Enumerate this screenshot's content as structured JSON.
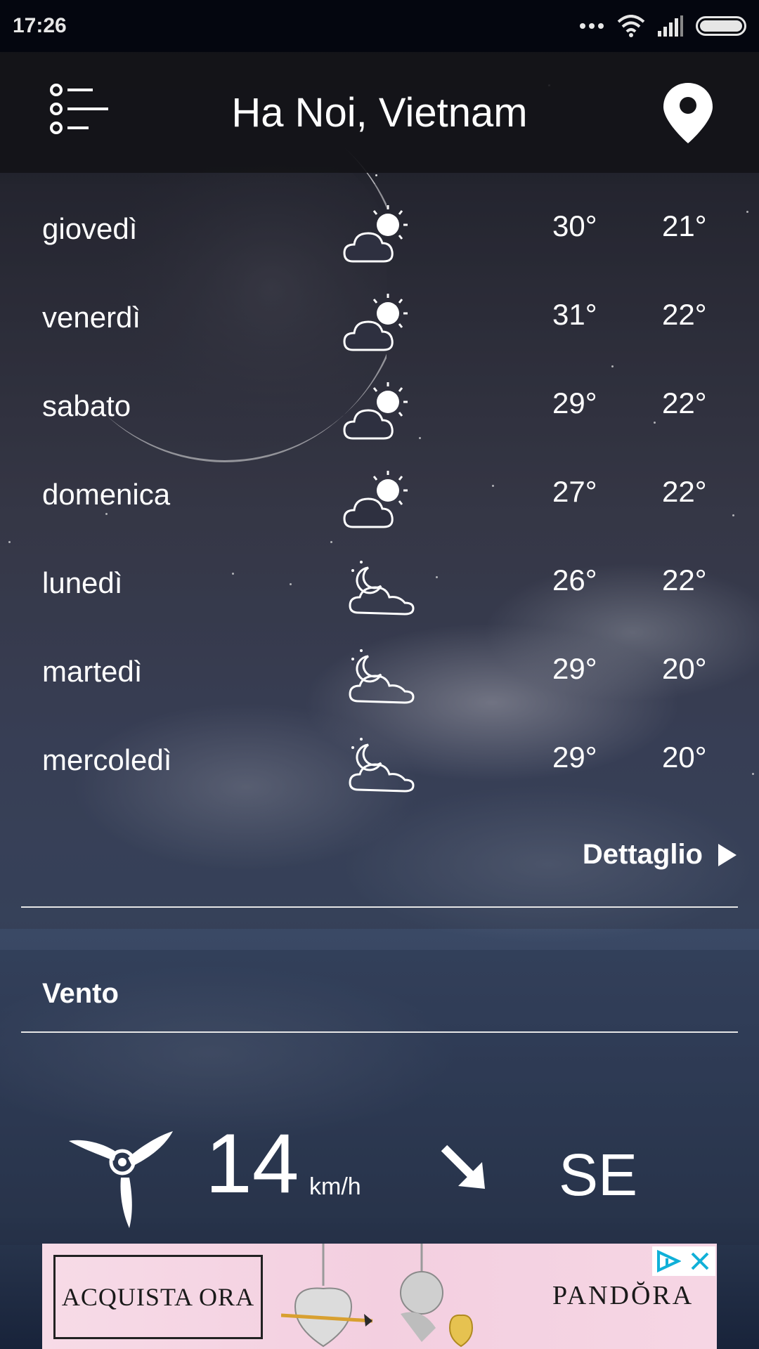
{
  "status_bar": {
    "time": "17:26",
    "icons": [
      "more-dots-icon",
      "wifi-icon",
      "signal-icon",
      "battery-icon"
    ]
  },
  "header": {
    "title": "Ha Noi, Vietnam",
    "menu_icon": "list-menu-icon",
    "location_icon": "location-pin-icon"
  },
  "forecast": {
    "days": [
      {
        "day": "giovedì",
        "icon": "partly-sunny-icon",
        "high": "30°",
        "low": "21°"
      },
      {
        "day": "venerdì",
        "icon": "partly-sunny-icon",
        "high": "31°",
        "low": "22°"
      },
      {
        "day": "sabato",
        "icon": "partly-sunny-icon",
        "high": "29°",
        "low": "22°"
      },
      {
        "day": "domenica",
        "icon": "partly-sunny-icon",
        "high": "27°",
        "low": "22°"
      },
      {
        "day": "lunedì",
        "icon": "night-cloudy-icon",
        "high": "26°",
        "low": "22°"
      },
      {
        "day": "martedì",
        "icon": "night-cloudy-icon",
        "high": "29°",
        "low": "20°"
      },
      {
        "day": "mercoledì",
        "icon": "night-cloudy-icon",
        "high": "29°",
        "low": "20°"
      }
    ],
    "detail_label": "Dettaglio"
  },
  "wind": {
    "title": "Vento",
    "speed": "14",
    "unit": "km/h",
    "direction": "SE"
  },
  "ad": {
    "cta": "ACQUISTA ORA",
    "brand": "PANDŎRA"
  },
  "colors": {
    "text": "#ffffff",
    "header_bg": "#141418",
    "status_bg": "#04060f",
    "ad_bg": "#f5d5e3"
  }
}
